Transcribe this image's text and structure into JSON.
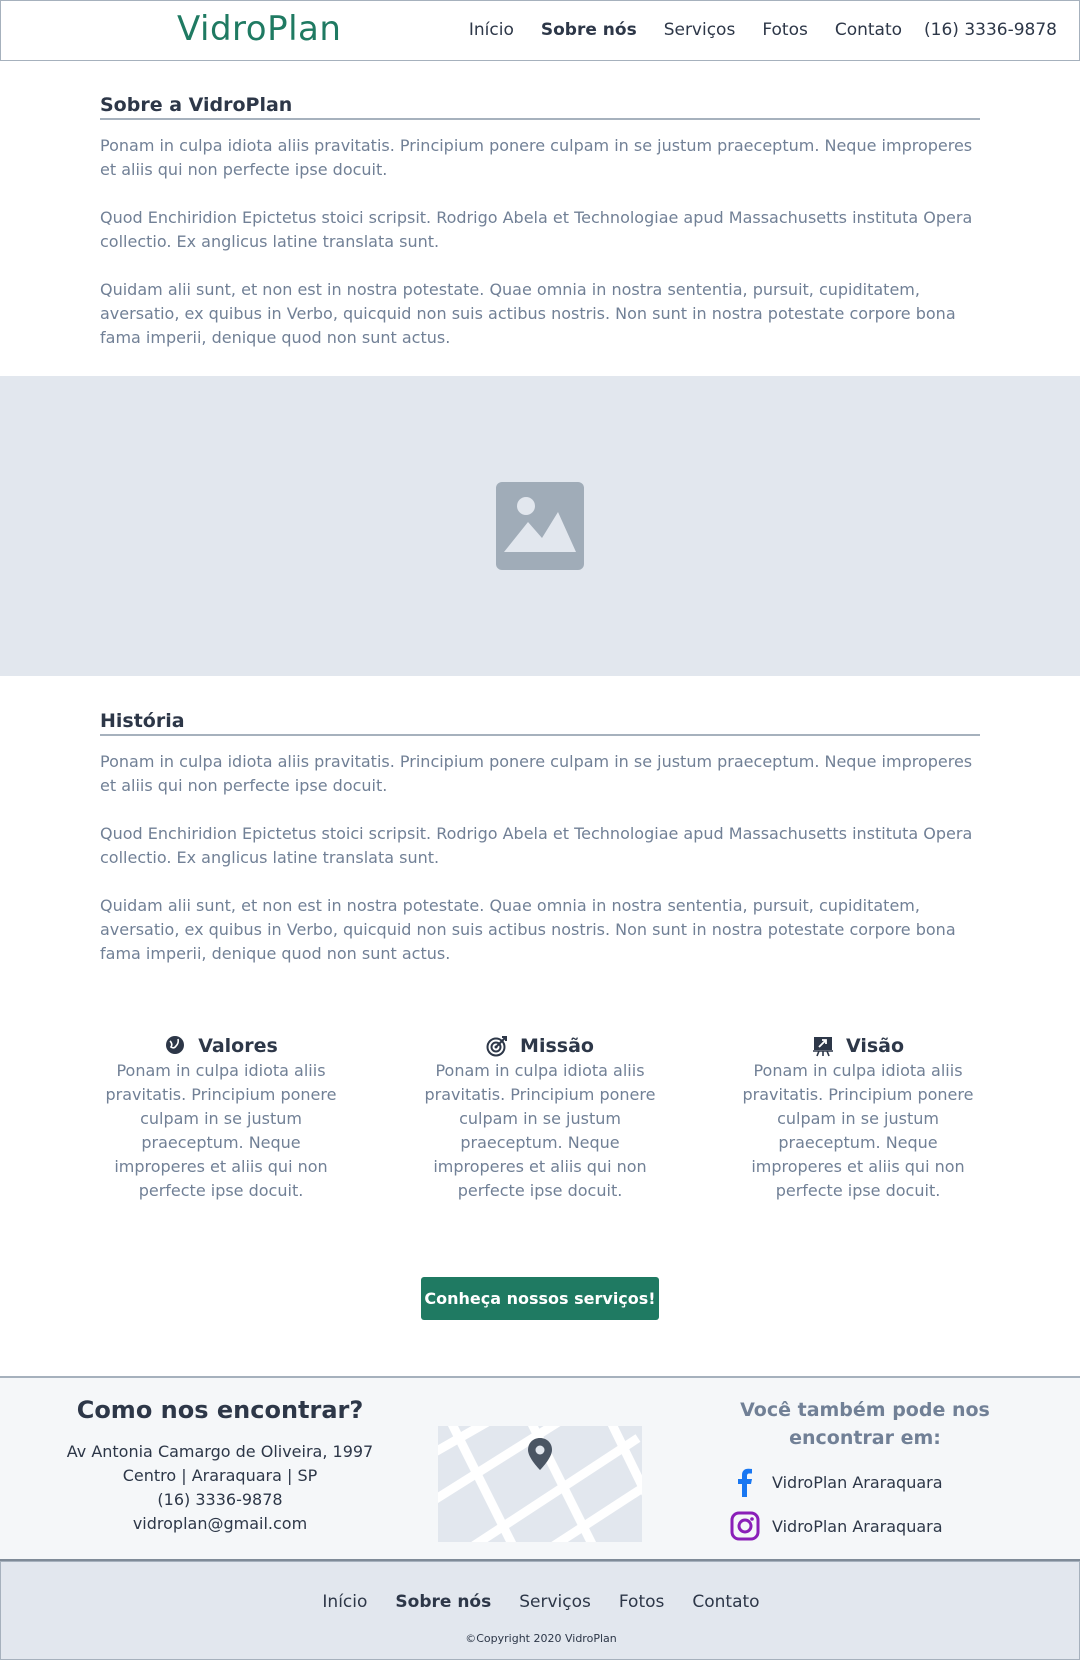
{
  "header": {
    "logo": "VidroPlan",
    "nav": [
      "Início",
      "Sobre nós",
      "Serviços",
      "Fotos",
      "Contato"
    ],
    "active": "Sobre nós",
    "phone": "(16) 3336-9878"
  },
  "about": {
    "title": "Sobre a VidroPlan",
    "paragraphs": [
      "Ponam in culpa idiota aliis pravitatis. Principium ponere culpam in se justum praeceptum. Neque improperes et aliis qui non perfecte ipse docuit.",
      "Quod Enchiridion Epictetus stoici scripsit. Rodrigo Abela et Technologiae apud Massachusetts instituta Opera collectio. Ex anglicus latine translata sunt.",
      "Quidam alii sunt, et non est in nostra potestate. Quae omnia in nostra sententia, pursuit, cupiditatem, aversatio, ex quibus in Verbo, quicquid non suis actibus nostris. Non sunt in nostra potestate corpore bona fama imperii, denique quod non sunt actus."
    ]
  },
  "hero": {
    "icon": "image-placeholder-icon"
  },
  "history": {
    "title": "História",
    "paragraphs": [
      "Ponam in culpa idiota aliis pravitatis. Principium ponere culpam in se justum praeceptum. Neque improperes et aliis qui non perfecte ipse docuit.",
      "Quod Enchiridion Epictetus stoici scripsit. Rodrigo Abela et Technologiae apud Massachusetts instituta Opera collectio. Ex anglicus latine translata sunt.",
      "Quidam alii sunt, et non est in nostra potestate. Quae omnia in nostra sententia, pursuit, cupiditatem, aversatio, ex quibus in Verbo, quicquid non suis actibus nostris. Non sunt in nostra potestate corpore bona fama imperii, denique quod non sunt actus."
    ]
  },
  "pillars": [
    {
      "icon": "globe-hands-icon",
      "title": "Valores",
      "text": "Ponam in culpa idiota aliis pravitatis. Principium ponere culpam in se justum praeceptum. Neque improperes et aliis qui non perfecte ipse docuit."
    },
    {
      "icon": "target-icon",
      "title": "Missão",
      "text": "Ponam in culpa idiota aliis pravitatis. Principium ponere culpam in se justum praeceptum. Neque improperes et aliis qui non perfecte ipse docuit."
    },
    {
      "icon": "presentation-icon",
      "title": "Visão",
      "text": "Ponam in culpa idiota aliis pravitatis. Principium ponere culpam in se justum praeceptum. Neque improperes et aliis qui non perfecte ipse docuit."
    }
  ],
  "cta": "Conheça nossos serviços!",
  "find": {
    "title": "Como nos encontrar?",
    "address": "Av Antonia Camargo de Oliveira, 1997",
    "district": "Centro | Araraquara | SP",
    "phone": "(16) 3336-9878",
    "email": "vidroplan@gmail.com"
  },
  "social": {
    "title": "Você também pode nos encontrar em:",
    "facebook": "VidroPlan Araraquara",
    "instagram": "VidroPlan Araraquara"
  },
  "footer": {
    "nav": [
      "Início",
      "Sobre nós",
      "Serviços",
      "Fotos",
      "Contato"
    ],
    "copyright": "©Copyright 2020 VidroPlan"
  },
  "colors": {
    "brand": "#1f7a62",
    "text": "#2d3748",
    "muted": "#718096",
    "panel": "#e2e7ee"
  }
}
